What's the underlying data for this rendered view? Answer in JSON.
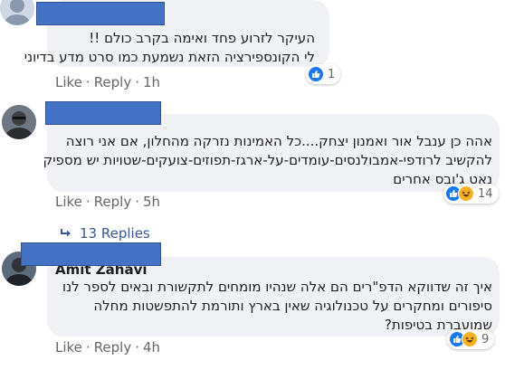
{
  "comments": [
    {
      "author": "",
      "lines": [
        "העיקר לזרוע פחד ואימה בקרב כולם !!",
        "לי הקונספירציה הזאת נשמעת כמו סרט מדע בדיוני"
      ],
      "like_label": "Like",
      "reply_label": "Reply",
      "time": "1h",
      "reactions_count": "1",
      "reaction_icons": [
        "like-icon"
      ]
    },
    {
      "author": "",
      "lines": [
        "אהה כן ענבל אור ואמנון יצחק....כל האמינות נזרקה מהחלון, אם אני רוצה",
        "להקשיב לרודפי-אמבולנסים-עומדים-על-ארגז-תפוזים-צועקים-שטויות יש מספיק",
        "נאט ג'ובס אחרים"
      ],
      "like_label": "Like",
      "reply_label": "Reply",
      "time": "5h",
      "reactions_count": "14",
      "reaction_icons": [
        "like-icon",
        "haha-icon"
      ],
      "replies_label": "13 Replies"
    },
    {
      "author": "Amit Zahavi",
      "lines": [
        "איך זה שדווקא הדפ\"רים הם אלה שנהיו מומחים לתקשורת ובאים לספר לנו",
        "סיפורים ומחקרים על טכנולוגיה שאין בארץ ותורמת להתפשטות מחלה",
        "שמועברת בטיפות?"
      ],
      "like_label": "Like",
      "reply_label": "Reply",
      "time": "4h",
      "reactions_count": "9",
      "reaction_icons": [
        "like-icon",
        "haha-icon"
      ]
    }
  ],
  "colors": {
    "bubble": "#f0f2f5",
    "redaction": "#4472c4",
    "meta_text": "#65676b",
    "link": "#385898",
    "like_blue": "#1877f2",
    "haha_yellow": "#f7b125"
  }
}
